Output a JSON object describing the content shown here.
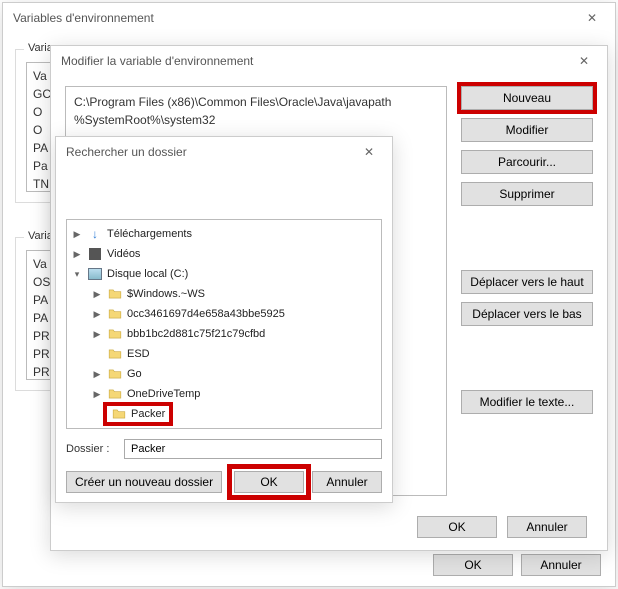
{
  "win_env": {
    "title": "Variables d'environnement",
    "group1_label": "Varia",
    "list1": [
      "Va",
      "GC",
      "O",
      "O",
      "PA",
      "Pa",
      "TN"
    ],
    "group2_label": "Varia",
    "list2": [
      "Va",
      "OS",
      "PA",
      "PA",
      "PR",
      "PR",
      "PR"
    ],
    "ok": "OK",
    "cancel": "Annuler"
  },
  "win_edit": {
    "title": "Modifier la variable d'environnement",
    "paths": [
      "C:\\Program Files (x86)\\Common Files\\Oracle\\Java\\javapath",
      "%SystemRoot%\\system32"
    ],
    "buttons": {
      "nouveau": "Nouveau",
      "modifier": "Modifier",
      "parcourir": "Parcourir...",
      "supprimer": "Supprimer",
      "move_up": "Déplacer vers le haut",
      "move_down": "Déplacer vers le bas",
      "edit_text": "Modifier le texte..."
    },
    "ok": "OK",
    "cancel": "Annuler"
  },
  "win_browse": {
    "title": "Rechercher un dossier",
    "tree": {
      "downloads": "Téléchargements",
      "videos": "Vidéos",
      "disk": "Disque local (C:)",
      "children": [
        "$Windows.~WS",
        "0cc3461697d4e658a43bbe5925",
        "bbb1bc2d881c75f21c79cfbd",
        "ESD",
        "Go",
        "OneDriveTemp",
        "Packer"
      ]
    },
    "dossier_label": "Dossier :",
    "dossier_value": "Packer",
    "new_folder": "Créer un nouveau dossier",
    "ok": "OK",
    "cancel": "Annuler"
  }
}
